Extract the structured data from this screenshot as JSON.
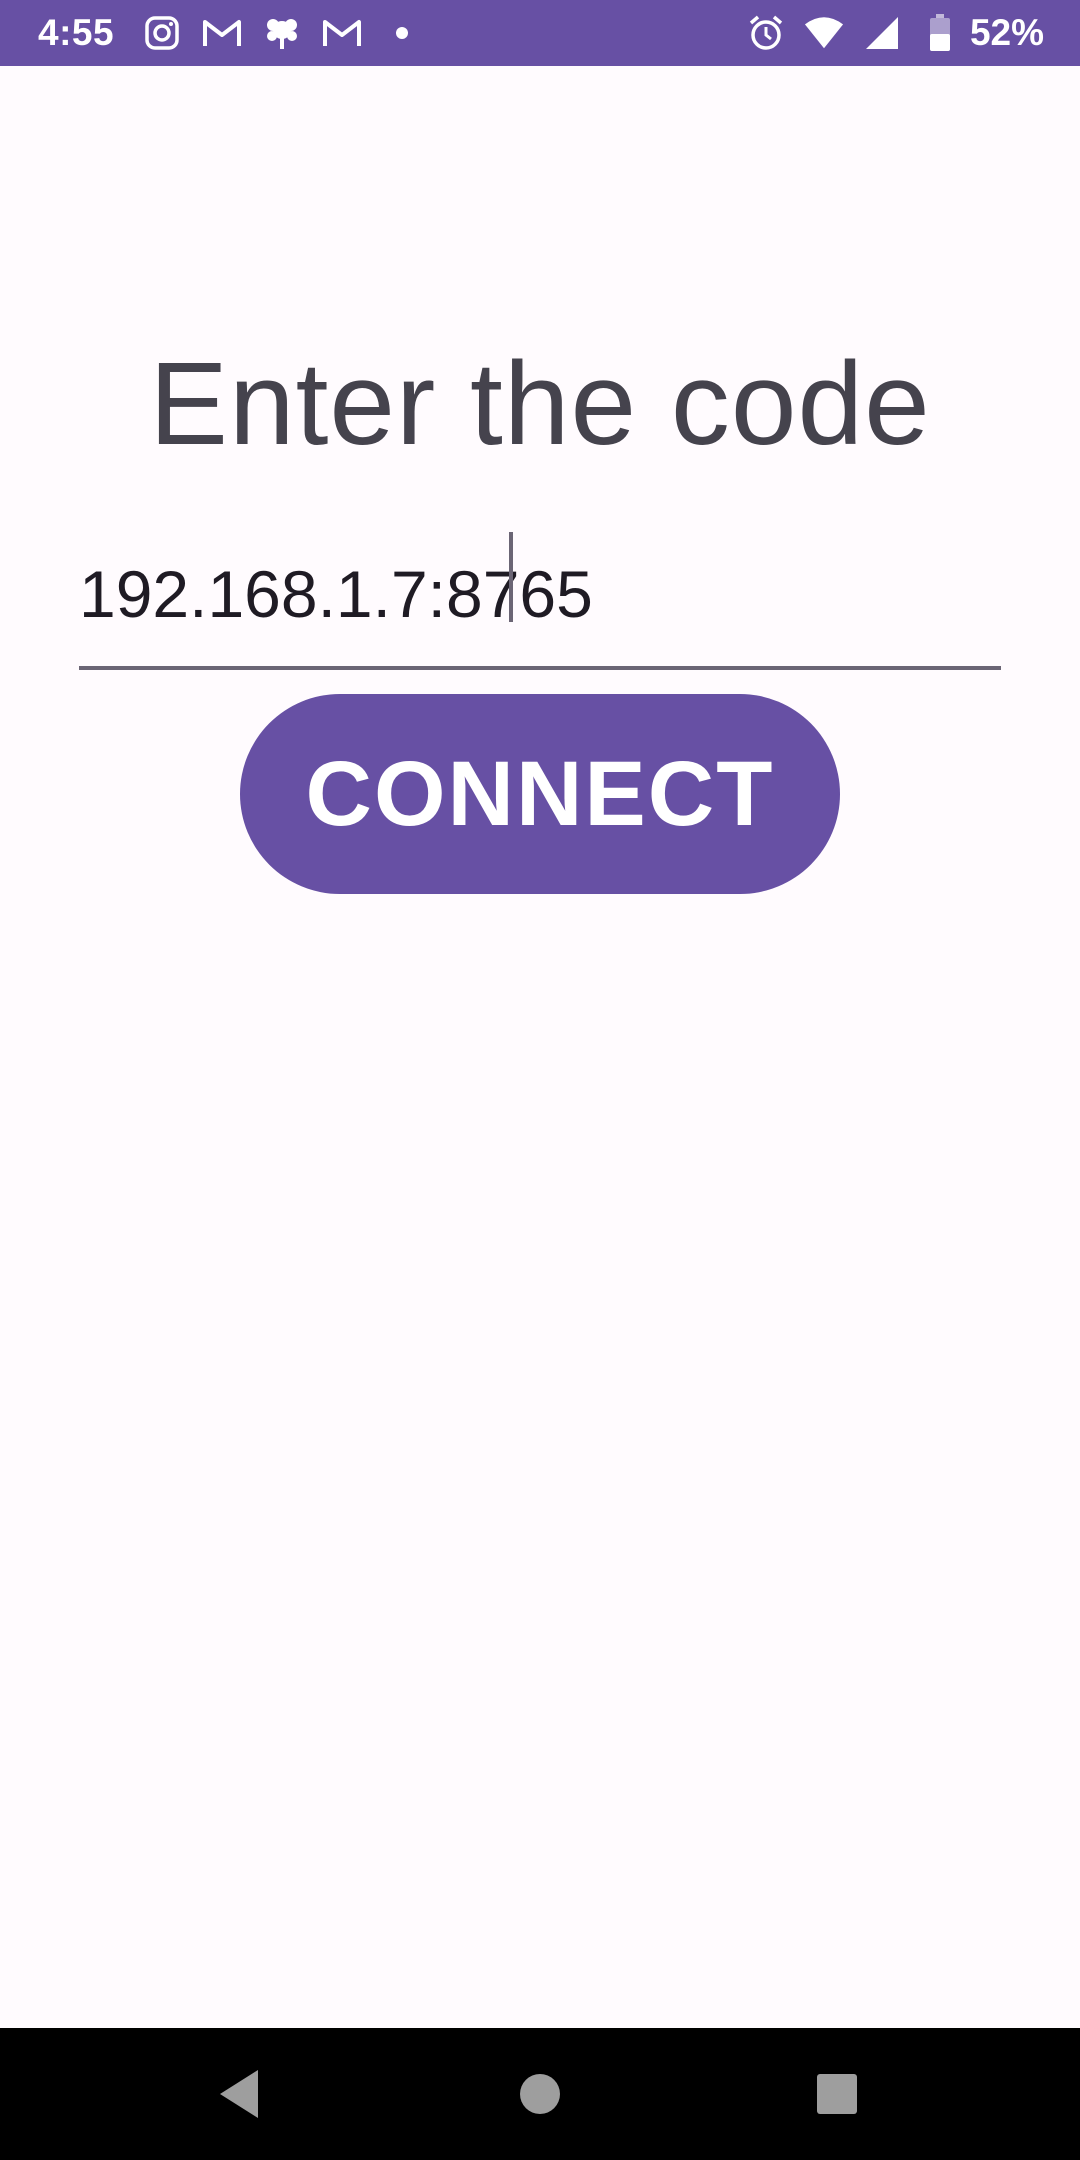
{
  "status_bar": {
    "time": "4:55",
    "notification_icons": [
      "instagram-icon",
      "gmail-icon",
      "flower-app-icon",
      "gmail-icon"
    ],
    "system_icons": [
      "alarm-icon",
      "wifi-icon",
      "signal-icon",
      "battery-icon"
    ],
    "battery_percent": "52%",
    "color": "#6750a4"
  },
  "main": {
    "title": "Enter the code",
    "code_field": {
      "value": "192.168.1.7:8765",
      "placeholder": ""
    },
    "connect_button_label": "CONNECT",
    "accent_color": "#6750a4"
  },
  "nav_bar": {
    "buttons": [
      "back-icon",
      "home-icon",
      "recents-icon"
    ]
  }
}
